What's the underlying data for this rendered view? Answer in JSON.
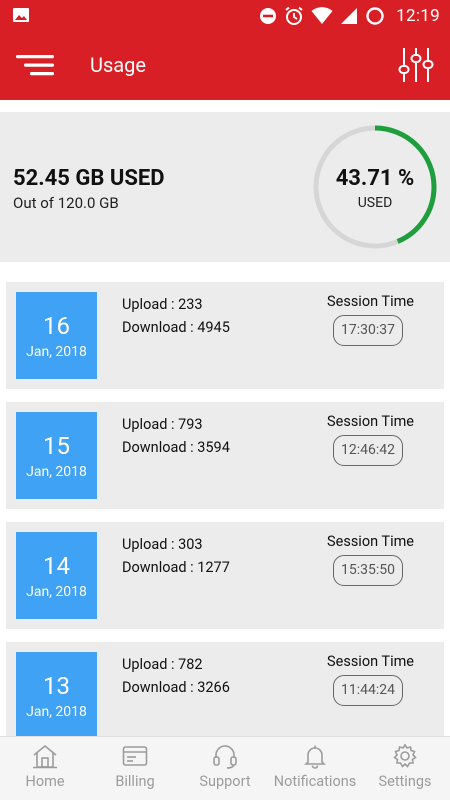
{
  "status_bar": {
    "time": "12:19"
  },
  "app_bar": {
    "title": "Usage"
  },
  "summary": {
    "used_text": "52.45 GB USED",
    "total_text": "Out of 120.0 GB",
    "percent_text": "43.71 %",
    "percent_label": "USED",
    "percent_value": 43.71
  },
  "sessions": [
    {
      "day": "16",
      "month_year": "Jan, 2018",
      "upload": "Upload : 233",
      "download": "Download : 4945",
      "session_label": "Session Time",
      "session_time": "17:30:37"
    },
    {
      "day": "15",
      "month_year": "Jan, 2018",
      "upload": "Upload : 793",
      "download": "Download : 3594",
      "session_label": "Session Time",
      "session_time": "12:46:42"
    },
    {
      "day": "14",
      "month_year": "Jan, 2018",
      "upload": "Upload : 303",
      "download": "Download : 1277",
      "session_label": "Session Time",
      "session_time": "15:35:50"
    },
    {
      "day": "13",
      "month_year": "Jan, 2018",
      "upload": "Upload : 782",
      "download": "Download : 3266",
      "session_label": "Session Time",
      "session_time": "11:44:24"
    }
  ],
  "bottom_nav": [
    {
      "label": "Home",
      "icon": "home-icon"
    },
    {
      "label": "Billing",
      "icon": "billing-icon"
    },
    {
      "label": "Support",
      "icon": "headset-icon"
    },
    {
      "label": "Notifications",
      "icon": "bell-icon"
    },
    {
      "label": "Settings",
      "icon": "gear-icon"
    }
  ],
  "colors": {
    "brand_red": "#d91f26",
    "date_blue": "#3fa2f4",
    "gauge_green": "#1e9e3c",
    "gauge_track": "#d6d6d6",
    "card_gray": "#ececec"
  }
}
